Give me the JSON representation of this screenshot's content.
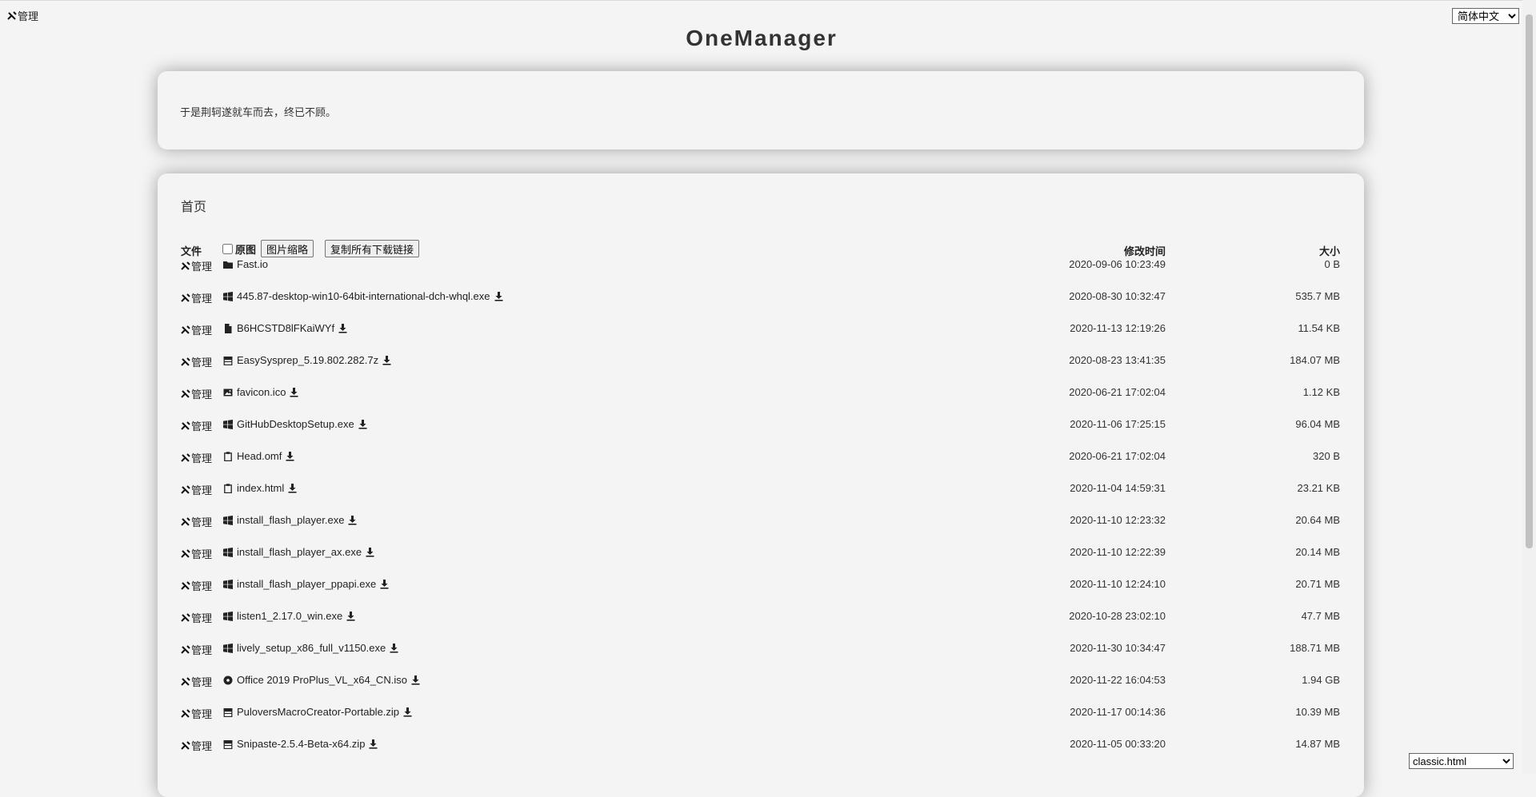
{
  "header": {
    "admin_label": "管理",
    "language_selected": "简体中文",
    "title": "OneManager"
  },
  "readme": {
    "text": "于是荆轲遂就车而去，终已不顾。"
  },
  "listing": {
    "breadcrumb": "首页",
    "col_file": "文件",
    "original_label": "原图",
    "thumb_button": "图片缩略",
    "copy_button": "复制所有下载链接",
    "col_time": "修改时间",
    "col_size": "大小",
    "admin_label": "管理",
    "items": [
      {
        "name": "Fast.io",
        "icon": "folder-icon",
        "time": "2020-09-06 10:23:49",
        "size": "0 B",
        "download": false
      },
      {
        "name": "445.87-desktop-win10-64bit-international-dch-whql.exe",
        "icon": "windows-icon",
        "time": "2020-08-30 10:32:47",
        "size": "535.7 MB",
        "download": true
      },
      {
        "name": "B6HCSTD8lFKaiWYf",
        "icon": "file-icon",
        "time": "2020-11-13 12:19:26",
        "size": "11.54 KB",
        "download": true
      },
      {
        "name": "EasySysprep_5.19.802.282.7z",
        "icon": "archive-icon",
        "time": "2020-08-23 13:41:35",
        "size": "184.07 MB",
        "download": true
      },
      {
        "name": "favicon.ico",
        "icon": "image-icon",
        "time": "2020-06-21 17:02:04",
        "size": "1.12 KB",
        "download": true
      },
      {
        "name": "GitHubDesktopSetup.exe",
        "icon": "windows-icon",
        "time": "2020-11-06 17:25:15",
        "size": "96.04 MB",
        "download": true
      },
      {
        "name": "Head.omf",
        "icon": "clipboard-icon",
        "time": "2020-06-21 17:02:04",
        "size": "320 B",
        "download": true
      },
      {
        "name": "index.html",
        "icon": "clipboard-icon",
        "time": "2020-11-04 14:59:31",
        "size": "23.21 KB",
        "download": true
      },
      {
        "name": "install_flash_player.exe",
        "icon": "windows-icon",
        "time": "2020-11-10 12:23:32",
        "size": "20.64 MB",
        "download": true
      },
      {
        "name": "install_flash_player_ax.exe",
        "icon": "windows-icon",
        "time": "2020-11-10 12:22:39",
        "size": "20.14 MB",
        "download": true
      },
      {
        "name": "install_flash_player_ppapi.exe",
        "icon": "windows-icon",
        "time": "2020-11-10 12:24:10",
        "size": "20.71 MB",
        "download": true
      },
      {
        "name": "listen1_2.17.0_win.exe",
        "icon": "windows-icon",
        "time": "2020-10-28 23:02:10",
        "size": "47.7 MB",
        "download": true
      },
      {
        "name": "lively_setup_x86_full_v1150.exe",
        "icon": "windows-icon",
        "time": "2020-11-30 10:34:47",
        "size": "188.71 MB",
        "download": true
      },
      {
        "name": "Office 2019 ProPlus_VL_x64_CN.iso",
        "icon": "disc-icon",
        "time": "2020-11-22 16:04:53",
        "size": "1.94 GB",
        "download": true
      },
      {
        "name": "PuloversMacroCreator-Portable.zip",
        "icon": "archive-icon",
        "time": "2020-11-17 00:14:36",
        "size": "10.39 MB",
        "download": true
      },
      {
        "name": "Snipaste-2.5.4-Beta-x64.zip",
        "icon": "archive-icon",
        "time": "2020-11-05 00:33:20",
        "size": "14.87 MB",
        "download": true
      }
    ]
  },
  "footer": {
    "theme_selected": "classic.html"
  }
}
